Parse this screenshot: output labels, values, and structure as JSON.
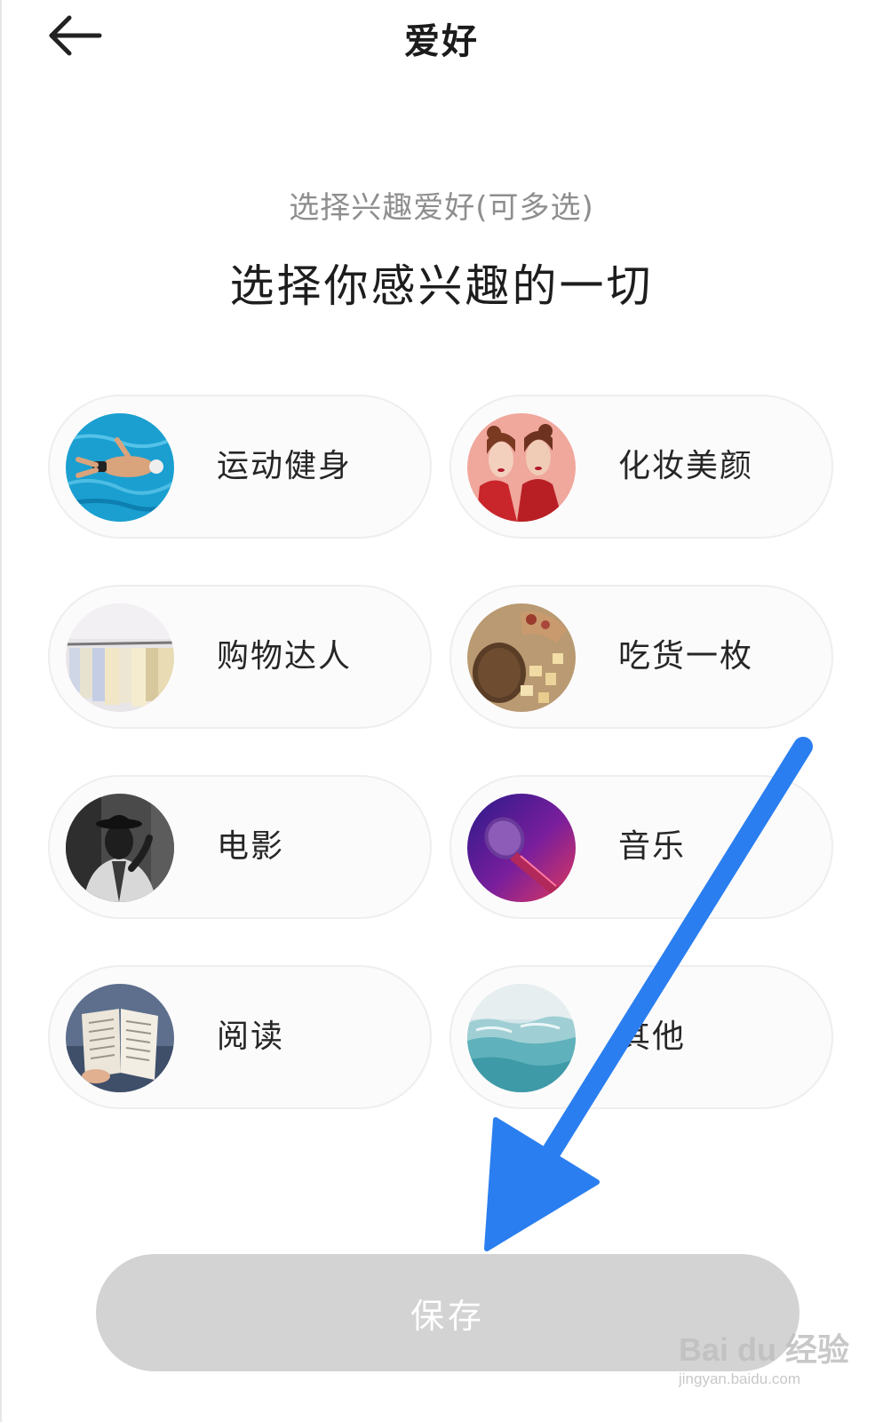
{
  "header": {
    "title": "爱好",
    "back_icon": "arrow-left-icon"
  },
  "intro": {
    "subtitle": "选择兴趣爱好(可多选)",
    "headline": "选择你感兴趣的一切"
  },
  "interests": [
    {
      "label": "运动健身",
      "image": "swimmer-photo"
    },
    {
      "label": "化妆美颜",
      "image": "makeup-models-photo"
    },
    {
      "label": "购物达人",
      "image": "clothing-rack-photo"
    },
    {
      "label": "吃货一枚",
      "image": "food-platter-photo"
    },
    {
      "label": "电影",
      "image": "vintage-movie-man-photo"
    },
    {
      "label": "音乐",
      "image": "microphone-photo"
    },
    {
      "label": "阅读",
      "image": "open-book-photo"
    },
    {
      "label": "其他",
      "image": "ocean-waves-photo"
    }
  ],
  "save_button": {
    "label": "保存",
    "state": "disabled"
  },
  "annotation": {
    "arrow_color": "#2a7ef0"
  },
  "watermark": {
    "main": "Bai du 经验",
    "sub": "jingyan.baidu.com"
  },
  "colors": {
    "card_bg": "#fcfbfc",
    "card_border": "#efedef",
    "save_bg": "#d3d3d3",
    "subtitle": "#8e8e8e"
  }
}
